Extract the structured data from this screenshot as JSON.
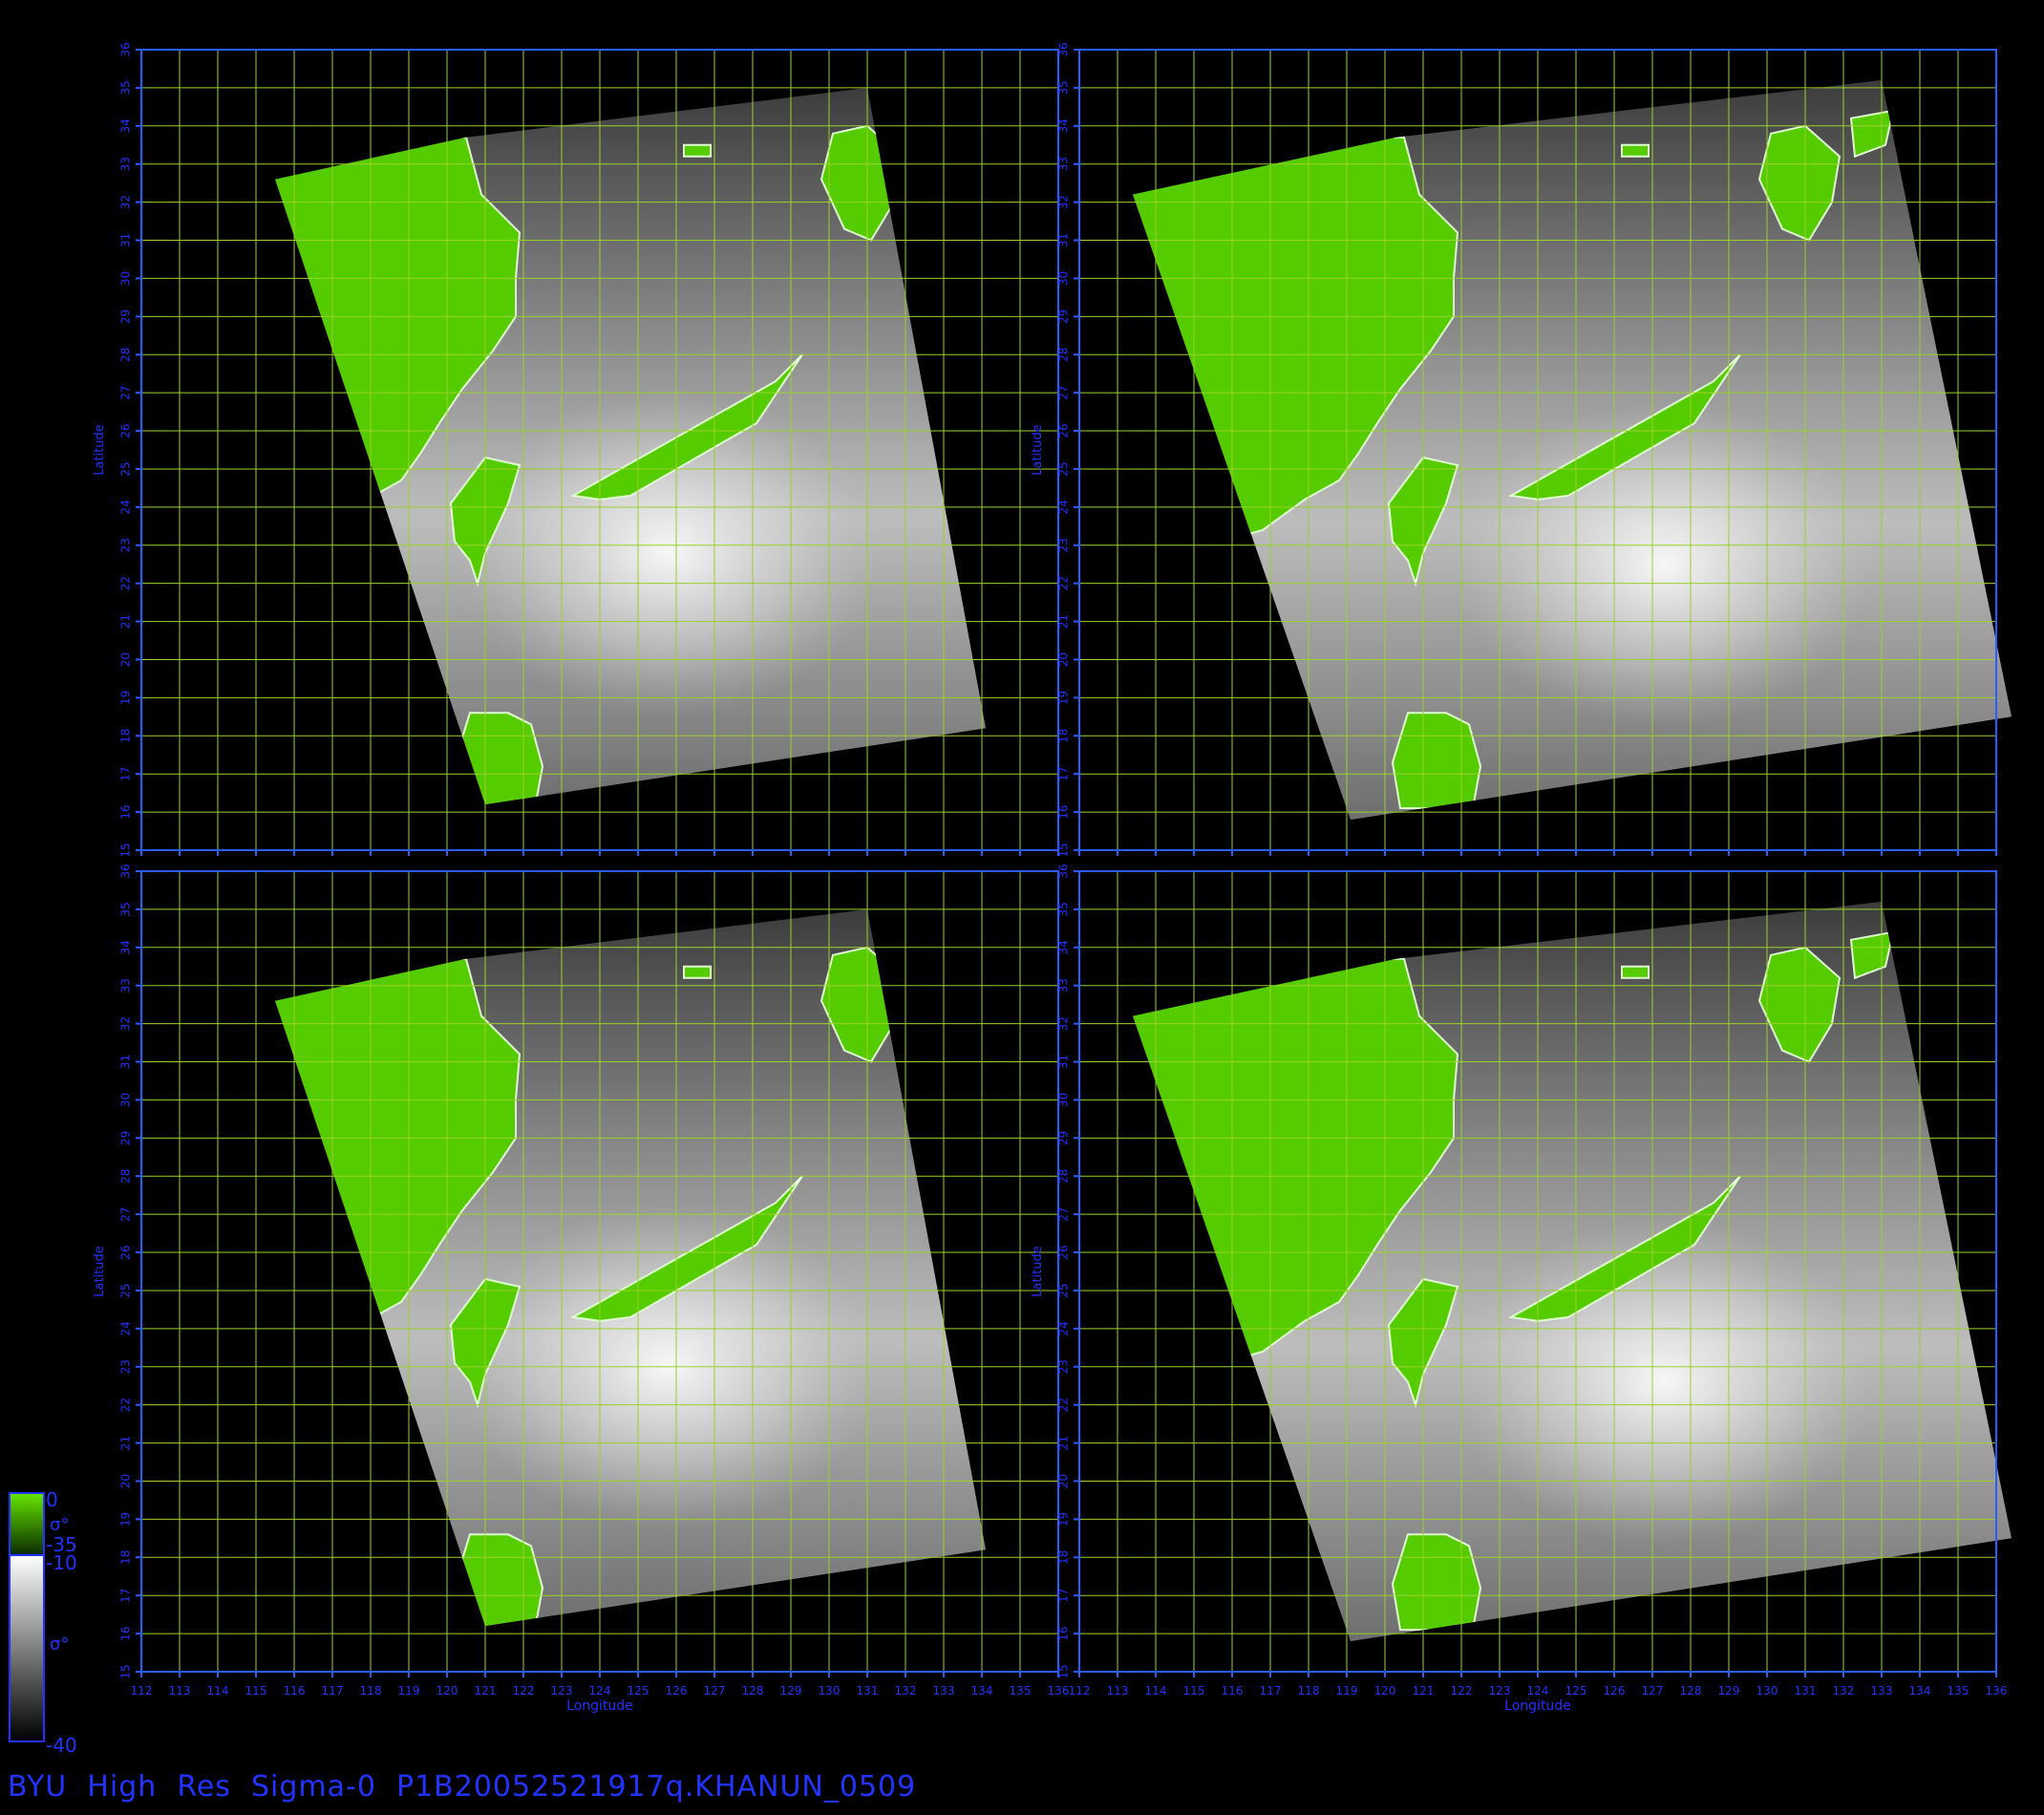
{
  "title": "BYU  High  Res  Sigma-0  P1B20052521917q.KHANUN_0509",
  "axes": {
    "xlabel": "Longitude",
    "ylabel": "Latitude",
    "lon_range": [
      112,
      136
    ],
    "lat_range": [
      15,
      36
    ],
    "lon_ticks": [
      "112",
      "113",
      "114",
      "115",
      "116",
      "117",
      "118",
      "119",
      "120",
      "121",
      "122",
      "123",
      "124",
      "125",
      "126",
      "127",
      "128",
      "129",
      "130",
      "131",
      "132",
      "133",
      "134",
      "135",
      "136"
    ],
    "lat_ticks": [
      "15",
      "16",
      "17",
      "18",
      "19",
      "20",
      "21",
      "22",
      "23",
      "24",
      "25",
      "26",
      "27",
      "28",
      "29",
      "30",
      "31",
      "32",
      "33",
      "34",
      "35",
      "36"
    ]
  },
  "colors": {
    "frame": "#2a5cff",
    "grid": "#9bd12a",
    "land": "#55cc00",
    "label": "#2233ff"
  },
  "colorbars": {
    "land": {
      "top": "0",
      "bottom": "-35",
      "symbol": "σ°"
    },
    "ocean": {
      "top": "-10",
      "bottom": "-40",
      "symbol": "σ°"
    }
  },
  "panels": [
    {
      "id": "top-left",
      "swath": [
        [
          115.5,
          32.6
        ],
        [
          120.5,
          33.7
        ],
        [
          131.0,
          35.0
        ],
        [
          134.1,
          18.2
        ],
        [
          121.0,
          16.2
        ]
      ],
      "typhoon": [
        125.8,
        22.8
      ]
    },
    {
      "id": "top-right",
      "swath": [
        [
          113.4,
          32.2
        ],
        [
          120.3,
          33.7
        ],
        [
          133.0,
          35.2
        ],
        [
          136.4,
          18.5
        ],
        [
          119.1,
          15.8
        ]
      ],
      "typhoon": [
        127.3,
        22.5
      ]
    },
    {
      "id": "bottom-left",
      "swath": [
        [
          115.5,
          32.6
        ],
        [
          120.5,
          33.7
        ],
        [
          131.0,
          35.0
        ],
        [
          134.1,
          18.2
        ],
        [
          121.0,
          16.2
        ]
      ],
      "typhoon": [
        125.8,
        23.0
      ]
    },
    {
      "id": "bottom-right",
      "swath": [
        [
          113.4,
          32.2
        ],
        [
          120.3,
          33.7
        ],
        [
          133.0,
          35.2
        ],
        [
          136.4,
          18.5
        ],
        [
          119.1,
          15.8
        ]
      ],
      "typhoon": [
        127.3,
        22.6
      ]
    }
  ],
  "land": {
    "mainland": [
      [
        112,
        33.7
      ],
      [
        120.5,
        33.7
      ],
      [
        120.9,
        32.2
      ],
      [
        121.9,
        31.2
      ],
      [
        121.8,
        30.0
      ],
      [
        121.8,
        29.0
      ],
      [
        121.2,
        28.1
      ],
      [
        120.4,
        27.1
      ],
      [
        119.8,
        26.2
      ],
      [
        119.3,
        25.4
      ],
      [
        118.8,
        24.7
      ],
      [
        117.9,
        24.2
      ],
      [
        116.8,
        23.4
      ],
      [
        112,
        22.0
      ]
    ],
    "taiwan": [
      [
        121.0,
        25.3
      ],
      [
        121.9,
        25.1
      ],
      [
        121.6,
        24.1
      ],
      [
        121.0,
        22.8
      ],
      [
        120.8,
        22.0
      ],
      [
        120.6,
        22.6
      ],
      [
        120.2,
        23.1
      ],
      [
        120.1,
        24.1
      ]
    ],
    "luzon": [
      [
        120.6,
        18.6
      ],
      [
        121.6,
        18.6
      ],
      [
        122.2,
        18.3
      ],
      [
        122.5,
        17.2
      ],
      [
        122.3,
        16.1
      ],
      [
        120.4,
        16.1
      ],
      [
        120.2,
        17.3
      ]
    ],
    "kyushu": [
      [
        130.1,
        33.8
      ],
      [
        131.0,
        34.0
      ],
      [
        131.9,
        33.2
      ],
      [
        131.7,
        32.0
      ],
      [
        131.1,
        31.0
      ],
      [
        130.4,
        31.3
      ],
      [
        129.8,
        32.6
      ]
    ],
    "shikoku": [
      [
        132.2,
        34.2
      ],
      [
        133.3,
        34.4
      ],
      [
        133.1,
        33.5
      ],
      [
        132.3,
        33.2
      ]
    ],
    "jeju": [
      [
        126.2,
        33.5
      ],
      [
        126.9,
        33.5
      ],
      [
        126.9,
        33.2
      ],
      [
        126.2,
        33.2
      ]
    ],
    "ryukyu": [
      [
        128.6,
        27.3
      ],
      [
        129.3,
        28.0
      ],
      [
        128.1,
        26.2
      ],
      [
        127.4,
        25.8
      ],
      [
        124.8,
        24.3
      ],
      [
        124.0,
        24.2
      ],
      [
        123.3,
        24.3
      ]
    ]
  }
}
